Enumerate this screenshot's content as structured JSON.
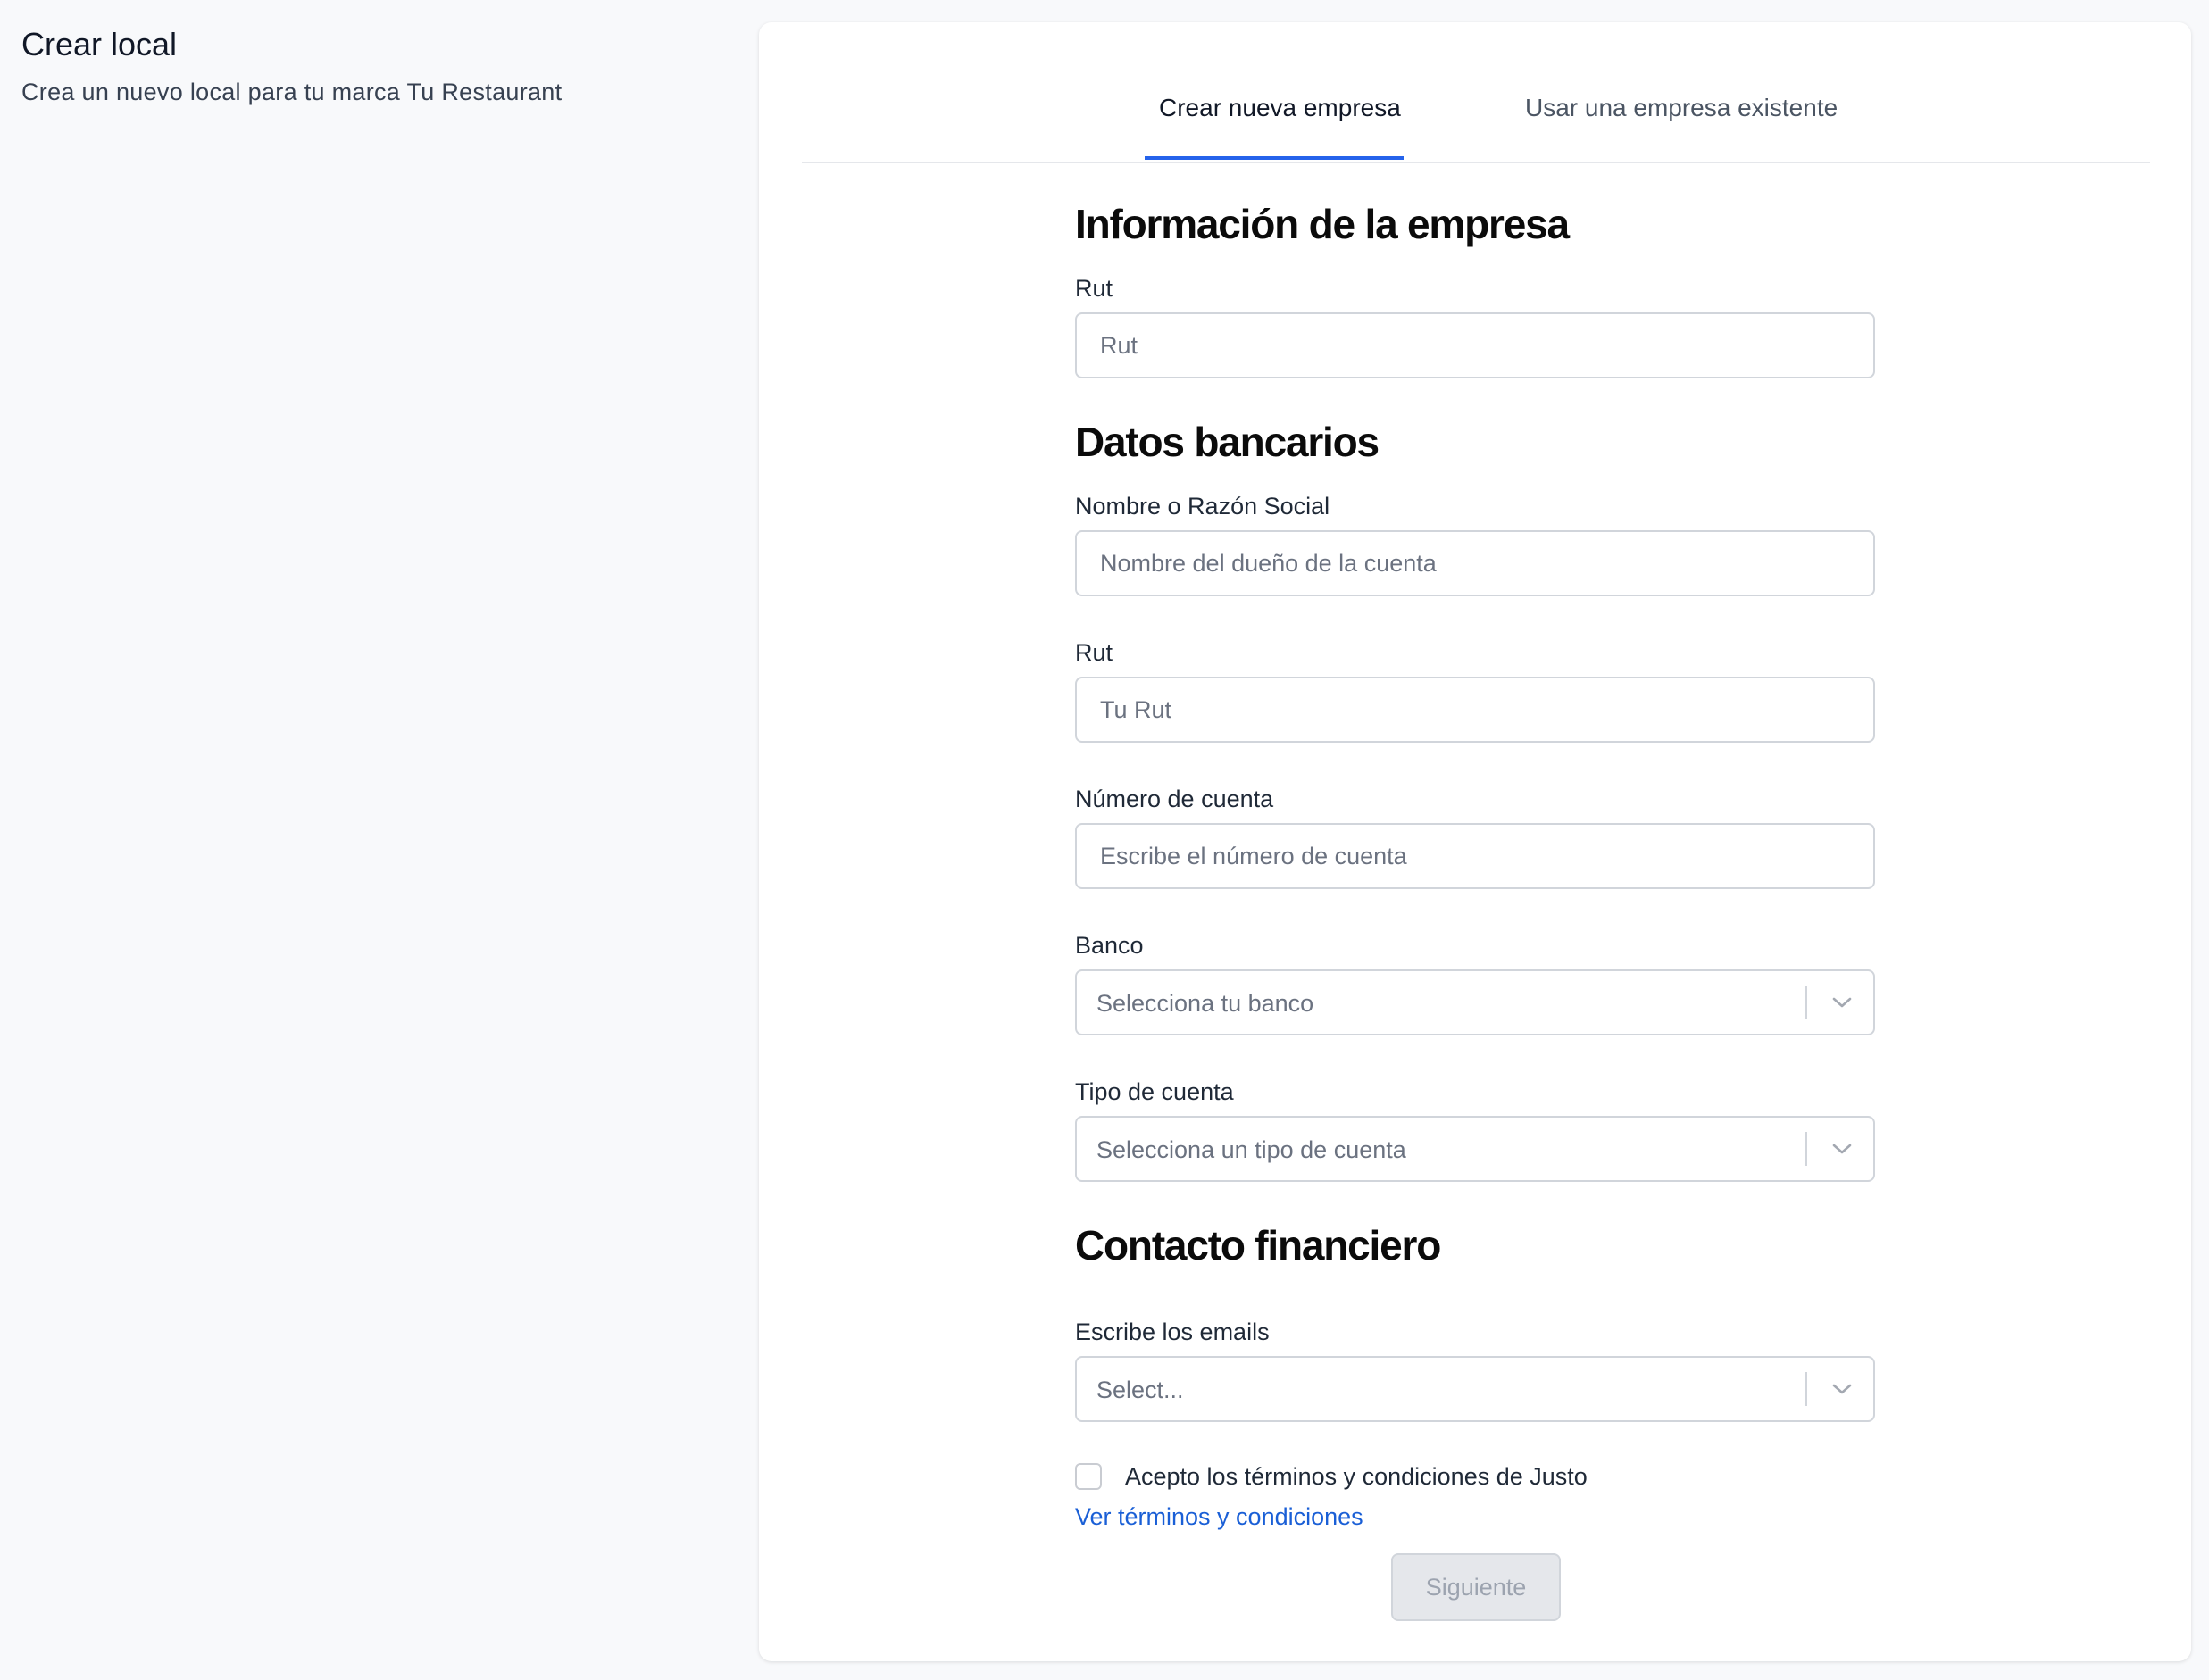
{
  "header": {
    "title": "Crear local",
    "subtitle": "Crea un nuevo local para tu marca Tu Restaurant"
  },
  "tabs": [
    {
      "label": "Crear nueva empresa",
      "active": true
    },
    {
      "label": "Usar una empresa existente",
      "active": false
    }
  ],
  "sections": {
    "company": {
      "title": "Información de la empresa",
      "rut": {
        "label": "Rut",
        "placeholder": "Rut",
        "value": ""
      }
    },
    "bank": {
      "title": "Datos bancarios",
      "name": {
        "label": "Nombre o Razón Social",
        "placeholder": "Nombre del dueño de la cuenta",
        "value": ""
      },
      "rut": {
        "label": "Rut",
        "placeholder": "Tu Rut",
        "value": ""
      },
      "account_number": {
        "label": "Número de cuenta",
        "placeholder": "Escribe el número de cuenta",
        "value": ""
      },
      "bank": {
        "label": "Banco",
        "placeholder": "Selecciona tu banco"
      },
      "account_type": {
        "label": "Tipo de cuenta",
        "placeholder": "Selecciona un tipo de cuenta"
      }
    },
    "contact": {
      "title": "Contacto financiero",
      "emails": {
        "label": "Escribe los emails",
        "placeholder": "Select..."
      }
    }
  },
  "terms": {
    "checkbox_label": "Acepto los términos y condiciones de Justo",
    "checked": false,
    "link_label": "Ver términos y condiciones"
  },
  "actions": {
    "next_label": "Siguiente",
    "next_disabled": true
  },
  "colors": {
    "accent": "#2563eb",
    "link": "#1a5fd6",
    "page_background": "#f8f9fb",
    "card_background": "#ffffff",
    "border": "#d1d5db",
    "disabled_button": "#e5e7eb"
  },
  "icons": {
    "select_indicator": "chevron-down-icon"
  }
}
